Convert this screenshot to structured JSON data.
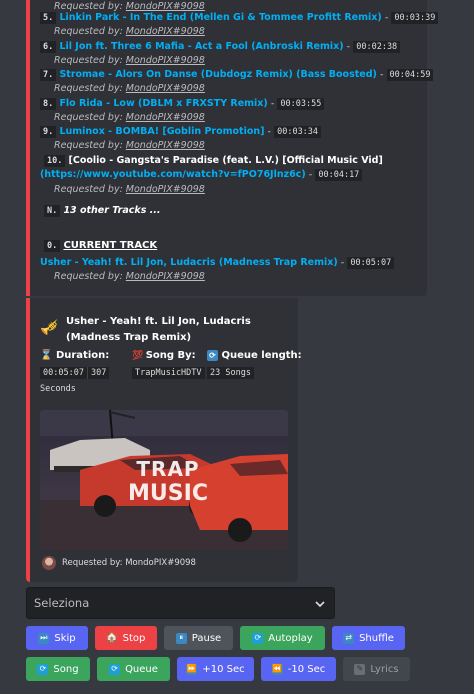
{
  "queue": {
    "items": [
      {
        "num": "5.",
        "title": "Linkin Park - In The End (Mellen Gi & Tommee Profitt Remix)",
        "duration": "00:03:39",
        "requested_prefix": "Requested by:",
        "requester": "MondoPIX#9098"
      },
      {
        "num": "6.",
        "title": "Lil Jon ft. Three 6 Mafia - Act a Fool (Anbroski Remix)",
        "duration": "00:02:38",
        "requested_prefix": "Requested by:",
        "requester": "MondoPIX#9098"
      },
      {
        "num": "7.",
        "title": "Stromae - Alors On Danse (Dubdogz Remix) (Bass Boosted)",
        "duration": "00:04:59",
        "requested_prefix": "Requested by:",
        "requester": "MondoPIX#9098"
      },
      {
        "num": "8.",
        "title": "Flo Rida - Low (DBLM x FRXSTY Remix)",
        "duration": "00:03:55",
        "requested_prefix": "Requested by:",
        "requester": "MondoPIX#9098"
      },
      {
        "num": "9.",
        "title": "Luminox - BOMBA! [Goblin Promotion]",
        "duration": "00:03:34",
        "requested_prefix": "Requested by:",
        "requester": "MondoPIX#9098"
      }
    ],
    "item10": {
      "num": "10.",
      "title_part1": "[Coolio - Gangsta's Paradise (feat. L.V.) [Official Music Vid]",
      "title_part2": "(https://www.youtube.com/watch?v=fPO76Jlnz6c)",
      "duration": "00:04:17",
      "requested_prefix": "Requested by:",
      "requester": "MondoPIX#9098"
    },
    "others": {
      "num": "N.",
      "text": "13 other Tracks ..."
    },
    "current": {
      "num": "0.",
      "heading": "CURRENT TRACK",
      "title": "Usher - Yeah! ft. Lil Jon, Ludacris (Madness Trap Remix)",
      "duration": "00:05:07",
      "requested_prefix": "Requested by:",
      "requester": "MondoPIX#9098"
    }
  },
  "now_playing": {
    "emoji": "🎺",
    "title": "Usher - Yeah! ft. Lil Jon, Ludacris (Madness Trap Remix)",
    "duration_label": "Duration:",
    "duration_code": "00:05:07",
    "duration_seconds": "307",
    "duration_unit": "Seconds",
    "song_by_label": "Song By:",
    "song_by_value": "TrapMusicHDTV",
    "queue_length_label": "Queue length:",
    "queue_length_value": "23 Songs",
    "thumbnail_text_top": "TRAP",
    "thumbnail_text_bottom": "MUSIC",
    "footer": "Requested by: MondoPIX#9098"
  },
  "select": {
    "placeholder": "Seleziona"
  },
  "buttons": {
    "skip": "Skip",
    "stop": "Stop",
    "pause": "Pause",
    "autoplay": "Autoplay",
    "shuffle": "Shuffle",
    "song": "Song",
    "queue": "Queue",
    "plus10": "+10 Sec",
    "minus10": "-10 Sec",
    "lyrics": "Lyrics"
  },
  "colors": {
    "accent": "#ed4245",
    "link": "#00aff4",
    "blurple": "#5865f2",
    "green": "#3ba55d",
    "gray": "#4f545c"
  }
}
